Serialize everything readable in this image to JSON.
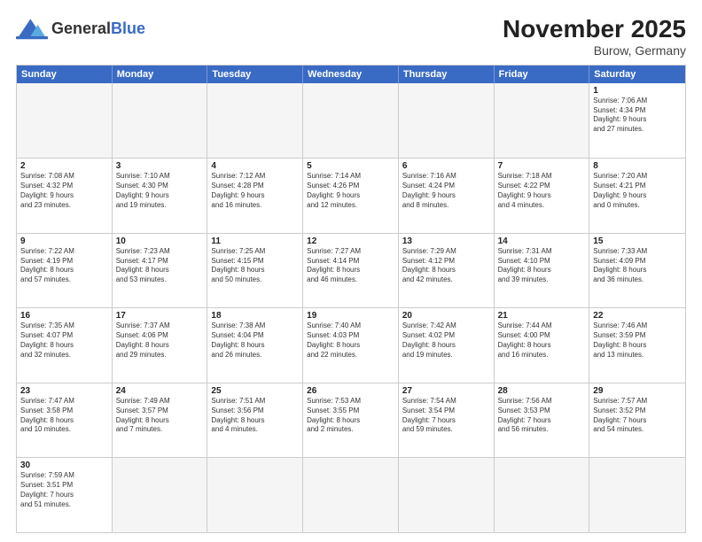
{
  "header": {
    "logo_general": "General",
    "logo_blue": "Blue",
    "month_title": "November 2025",
    "location": "Burow, Germany"
  },
  "weekdays": [
    "Sunday",
    "Monday",
    "Tuesday",
    "Wednesday",
    "Thursday",
    "Friday",
    "Saturday"
  ],
  "weeks": [
    [
      {
        "day": "",
        "text": "",
        "empty": true
      },
      {
        "day": "",
        "text": "",
        "empty": true
      },
      {
        "day": "",
        "text": "",
        "empty": true
      },
      {
        "day": "",
        "text": "",
        "empty": true
      },
      {
        "day": "",
        "text": "",
        "empty": true
      },
      {
        "day": "",
        "text": "",
        "empty": true
      },
      {
        "day": "1",
        "text": "Sunrise: 7:06 AM\nSunset: 4:34 PM\nDaylight: 9 hours\nand 27 minutes."
      }
    ],
    [
      {
        "day": "2",
        "text": "Sunrise: 7:08 AM\nSunset: 4:32 PM\nDaylight: 9 hours\nand 23 minutes."
      },
      {
        "day": "3",
        "text": "Sunrise: 7:10 AM\nSunset: 4:30 PM\nDaylight: 9 hours\nand 19 minutes."
      },
      {
        "day": "4",
        "text": "Sunrise: 7:12 AM\nSunset: 4:28 PM\nDaylight: 9 hours\nand 16 minutes."
      },
      {
        "day": "5",
        "text": "Sunrise: 7:14 AM\nSunset: 4:26 PM\nDaylight: 9 hours\nand 12 minutes."
      },
      {
        "day": "6",
        "text": "Sunrise: 7:16 AM\nSunset: 4:24 PM\nDaylight: 9 hours\nand 8 minutes."
      },
      {
        "day": "7",
        "text": "Sunrise: 7:18 AM\nSunset: 4:22 PM\nDaylight: 9 hours\nand 4 minutes."
      },
      {
        "day": "8",
        "text": "Sunrise: 7:20 AM\nSunset: 4:21 PM\nDaylight: 9 hours\nand 0 minutes."
      }
    ],
    [
      {
        "day": "9",
        "text": "Sunrise: 7:22 AM\nSunset: 4:19 PM\nDaylight: 8 hours\nand 57 minutes."
      },
      {
        "day": "10",
        "text": "Sunrise: 7:23 AM\nSunset: 4:17 PM\nDaylight: 8 hours\nand 53 minutes."
      },
      {
        "day": "11",
        "text": "Sunrise: 7:25 AM\nSunset: 4:15 PM\nDaylight: 8 hours\nand 50 minutes."
      },
      {
        "day": "12",
        "text": "Sunrise: 7:27 AM\nSunset: 4:14 PM\nDaylight: 8 hours\nand 46 minutes."
      },
      {
        "day": "13",
        "text": "Sunrise: 7:29 AM\nSunset: 4:12 PM\nDaylight: 8 hours\nand 42 minutes."
      },
      {
        "day": "14",
        "text": "Sunrise: 7:31 AM\nSunset: 4:10 PM\nDaylight: 8 hours\nand 39 minutes."
      },
      {
        "day": "15",
        "text": "Sunrise: 7:33 AM\nSunset: 4:09 PM\nDaylight: 8 hours\nand 36 minutes."
      }
    ],
    [
      {
        "day": "16",
        "text": "Sunrise: 7:35 AM\nSunset: 4:07 PM\nDaylight: 8 hours\nand 32 minutes."
      },
      {
        "day": "17",
        "text": "Sunrise: 7:37 AM\nSunset: 4:06 PM\nDaylight: 8 hours\nand 29 minutes."
      },
      {
        "day": "18",
        "text": "Sunrise: 7:38 AM\nSunset: 4:04 PM\nDaylight: 8 hours\nand 26 minutes."
      },
      {
        "day": "19",
        "text": "Sunrise: 7:40 AM\nSunset: 4:03 PM\nDaylight: 8 hours\nand 22 minutes."
      },
      {
        "day": "20",
        "text": "Sunrise: 7:42 AM\nSunset: 4:02 PM\nDaylight: 8 hours\nand 19 minutes."
      },
      {
        "day": "21",
        "text": "Sunrise: 7:44 AM\nSunset: 4:00 PM\nDaylight: 8 hours\nand 16 minutes."
      },
      {
        "day": "22",
        "text": "Sunrise: 7:46 AM\nSunset: 3:59 PM\nDaylight: 8 hours\nand 13 minutes."
      }
    ],
    [
      {
        "day": "23",
        "text": "Sunrise: 7:47 AM\nSunset: 3:58 PM\nDaylight: 8 hours\nand 10 minutes."
      },
      {
        "day": "24",
        "text": "Sunrise: 7:49 AM\nSunset: 3:57 PM\nDaylight: 8 hours\nand 7 minutes."
      },
      {
        "day": "25",
        "text": "Sunrise: 7:51 AM\nSunset: 3:56 PM\nDaylight: 8 hours\nand 4 minutes."
      },
      {
        "day": "26",
        "text": "Sunrise: 7:53 AM\nSunset: 3:55 PM\nDaylight: 8 hours\nand 2 minutes."
      },
      {
        "day": "27",
        "text": "Sunrise: 7:54 AM\nSunset: 3:54 PM\nDaylight: 7 hours\nand 59 minutes."
      },
      {
        "day": "28",
        "text": "Sunrise: 7:56 AM\nSunset: 3:53 PM\nDaylight: 7 hours\nand 56 minutes."
      },
      {
        "day": "29",
        "text": "Sunrise: 7:57 AM\nSunset: 3:52 PM\nDaylight: 7 hours\nand 54 minutes."
      }
    ],
    [
      {
        "day": "30",
        "text": "Sunrise: 7:59 AM\nSunset: 3:51 PM\nDaylight: 7 hours\nand 51 minutes."
      },
      {
        "day": "",
        "text": "",
        "empty": true
      },
      {
        "day": "",
        "text": "",
        "empty": true
      },
      {
        "day": "",
        "text": "",
        "empty": true
      },
      {
        "day": "",
        "text": "",
        "empty": true
      },
      {
        "day": "",
        "text": "",
        "empty": true
      },
      {
        "day": "",
        "text": "",
        "empty": true
      }
    ]
  ]
}
